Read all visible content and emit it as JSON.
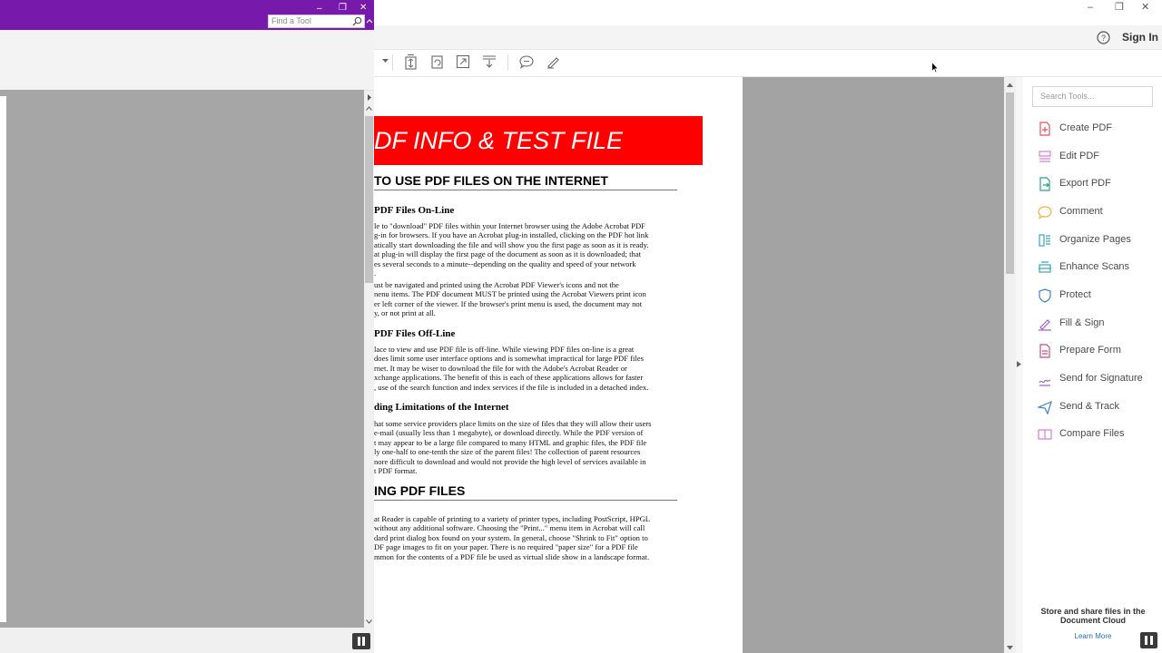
{
  "left_window": {
    "find_tool_placeholder": "Find a Tool",
    "title_buttons": [
      "–",
      "❐",
      "✕"
    ]
  },
  "acrobat": {
    "header": {
      "sign_in": "Sign In",
      "help": "?"
    },
    "window_buttons": [
      "–",
      "❐",
      "✕"
    ],
    "pdf": {
      "banner": "DF INFO & TEST FILE",
      "section1_title": "TO USE PDF FILES ON THE INTERNET",
      "sub1": "PDF Files On-Line",
      "para1": [
        "le to \"download\" PDF files within your Internet browser using the Adobe Acrobat PDF",
        "g-in for browsers. If you have an Acrobat plug-in installed, clicking on the PDF hot link",
        "atically start downloading the file and will show you the first page as soon as it is ready.",
        "at plug-in will display the first page of the document as soon as it is downloaded; that",
        "es several seconds to a minute--depending on the quality and speed of your network",
        "."
      ],
      "para2": [
        "ust be navigated and printed using the Acrobat PDF Viewer's icons and not the",
        "nenu items. The PDF document MUST be printed using the Acrobat Viewers print icon",
        "er left corner of the viewer. If the browser's print menu is used, the document may not",
        "y, or not print at all."
      ],
      "sub2": "PDF Files Off-Line",
      "para3": [
        "lace to view and use PDF file is off-line. While viewing PDF files on-line is a great",
        "does limit some user interface options and is somewhat impractical for large PDF files",
        "rnet. It may be wiser to download the file for with the Adobe's Acrobat Reader or",
        "xchange applications. The benefit of this is each of these applications allows for faster",
        ", use of the search function and index services if the file is included in a detached index."
      ],
      "sub3": "ding Limitations of the Internet",
      "para4": [
        "hat some service providers place limits on the size of files that they will allow their users",
        "e-mail (usually less than 1 megabyte), or download directly. While the PDF version of",
        "t may appear to be a large file compared to many HTML and graphic files, the PDF file",
        "ly one-half to one-tenth the size of the parent files! The collection of parent resources",
        "nore difficult to download and would not provide the high level of services available in",
        "t PDF format."
      ],
      "section2_title": "ING PDF FILES",
      "para5": [
        "at Reader is capable of printing to a variety of printer types, including PostScript, HPGL",
        "without any additional software. Choosing the \"Print...\" menu item in Acrobat will call",
        "dard print dialog box found on your system. In general, choose \"Shrink to Fit\" option to",
        "DF page images to fit on your paper. There is no required \"paper size\" for a PDF file",
        "mmon for the contents of a PDF file be used as virtual slide show in a landscape format."
      ]
    },
    "tools": {
      "search_placeholder": "Search Tools...",
      "items": [
        {
          "label": "Create PDF",
          "icon": "create-pdf-icon",
          "color": "#e5525a"
        },
        {
          "label": "Edit PDF",
          "icon": "edit-pdf-icon",
          "color": "#d77cd6"
        },
        {
          "label": "Export PDF",
          "icon": "export-pdf-icon",
          "color": "#26a37f"
        },
        {
          "label": "Comment",
          "icon": "comment-icon",
          "color": "#f2b43a"
        },
        {
          "label": "Organize Pages",
          "icon": "organize-pages-icon",
          "color": "#3aa7b8"
        },
        {
          "label": "Enhance Scans",
          "icon": "enhance-scans-icon",
          "color": "#3aa7b8"
        },
        {
          "label": "Protect",
          "icon": "protect-icon",
          "color": "#3d7fd6"
        },
        {
          "label": "Fill & Sign",
          "icon": "fill-sign-icon",
          "color": "#a25fd0"
        },
        {
          "label": "Prepare Form",
          "icon": "prepare-form-icon",
          "color": "#d24b8c"
        },
        {
          "label": "Send for Signature",
          "icon": "send-signature-icon",
          "color": "#a25fd0"
        },
        {
          "label": "Send & Track",
          "icon": "send-track-icon",
          "color": "#3d7fd6"
        },
        {
          "label": "Compare Files",
          "icon": "compare-files-icon",
          "color": "#d77cd6"
        }
      ],
      "cloud_text": "Store and share files in the Document Cloud",
      "learn_more": "Learn More"
    }
  }
}
